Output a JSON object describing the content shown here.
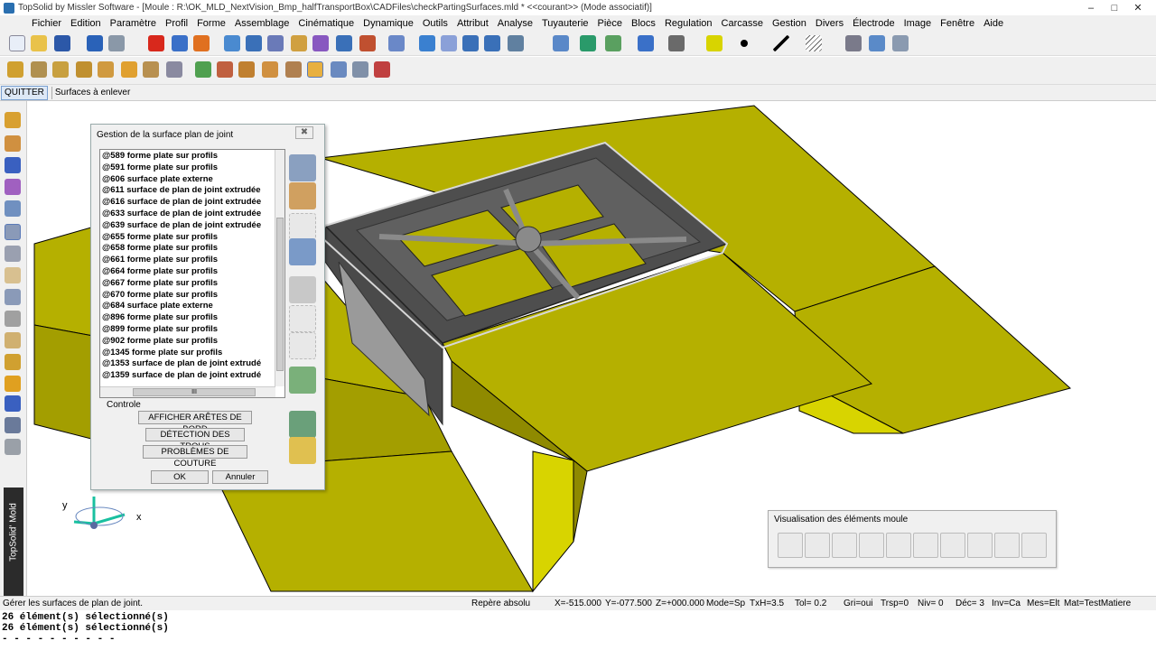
{
  "window": {
    "title": "TopSolid by Missler Software - [Moule : R:\\OK_MLD_NextVision_Bmp_halfTransportBox\\CADFiles\\checkPartingSurfaces.mld *  <<courant>> (Mode associatif)]",
    "controls": [
      "–",
      "□",
      "✕"
    ]
  },
  "menu": [
    "Fichier",
    "Edition",
    "Paramètre",
    "Profil",
    "Forme",
    "Assemblage",
    "Cinématique",
    "Dynamique",
    "Outils",
    "Attribut",
    "Analyse",
    "Tuyauterie",
    "Pièce",
    "Blocs",
    "Regulation",
    "Carcasse",
    "Gestion",
    "Divers",
    "Électrode",
    "Image",
    "Fenêtre",
    "Aide"
  ],
  "command_bar": {
    "quit": "QUITTER",
    "current_command": "Surfaces à enlever"
  },
  "brand": "TopSolid' Mold",
  "dialog": {
    "title": "Gestion de la surface plan de joint",
    "close": "✖",
    "items": [
      "@589 forme plate sur profils",
      "@591 forme plate sur profils",
      "@606 surface plate externe",
      "@611 surface de plan de joint extrudée",
      "@616 surface de plan de joint extrudée",
      "@633 surface de plan de joint extrudée",
      "@639 surface de plan de joint extrudée",
      "@655 forme plate sur profils",
      "@658 forme plate sur profils",
      "@661 forme plate sur profils",
      "@664 forme plate sur profils",
      "@667 forme plate sur profils",
      "@670 forme plate sur profils",
      "@684 surface plate externe",
      "@896 forme plate sur profils",
      "@899 forme plate sur profils",
      "@902 forme plate sur profils",
      "@1345 forme plate sur profils",
      "@1353 surface de plan de joint extrudé",
      "@1359 surface de plan de joint extrudé"
    ],
    "hscroll_thumb": "III",
    "controle_label": "Controle",
    "btn_edges": "AFFICHER ARÊTES DE BORD",
    "btn_holes": "DÉTECTION DES TROUS",
    "btn_seams": "PROBLÈMES DE COUTURE",
    "btn_ok": "OK",
    "btn_cancel": "Annuler"
  },
  "axes": {
    "y": "y",
    "x": "x"
  },
  "mold_panel": {
    "title": "Visualisation des éléments moule"
  },
  "status": {
    "hint": "Gérer les surfaces de plan de joint.",
    "frame": "Repère absolu",
    "x": "X=-515.000",
    "y": "Y=-077.500",
    "z": "Z=+000.000",
    "mode": "Mode=Sp",
    "txh": "TxH=3.5",
    "tol": "Tol=  0.2",
    "gri": "Gri=oui",
    "trsp": "Trsp=0",
    "niv": "Niv=  0",
    "dec": "Déc= 3",
    "inv": "Inv=Ca",
    "mes": "Mes=Elt",
    "mat": "Mat=TestMatiere"
  },
  "console": [
    "26 élément(s) sélectionné(s)",
    "26 élément(s) sélectionné(s)",
    "- - - - - - - - - -"
  ],
  "colors": {
    "surface": "#b5b000",
    "surface_dark": "#8f8a00",
    "part": "#4a4a4a",
    "part_light": "#b8b8b8"
  }
}
